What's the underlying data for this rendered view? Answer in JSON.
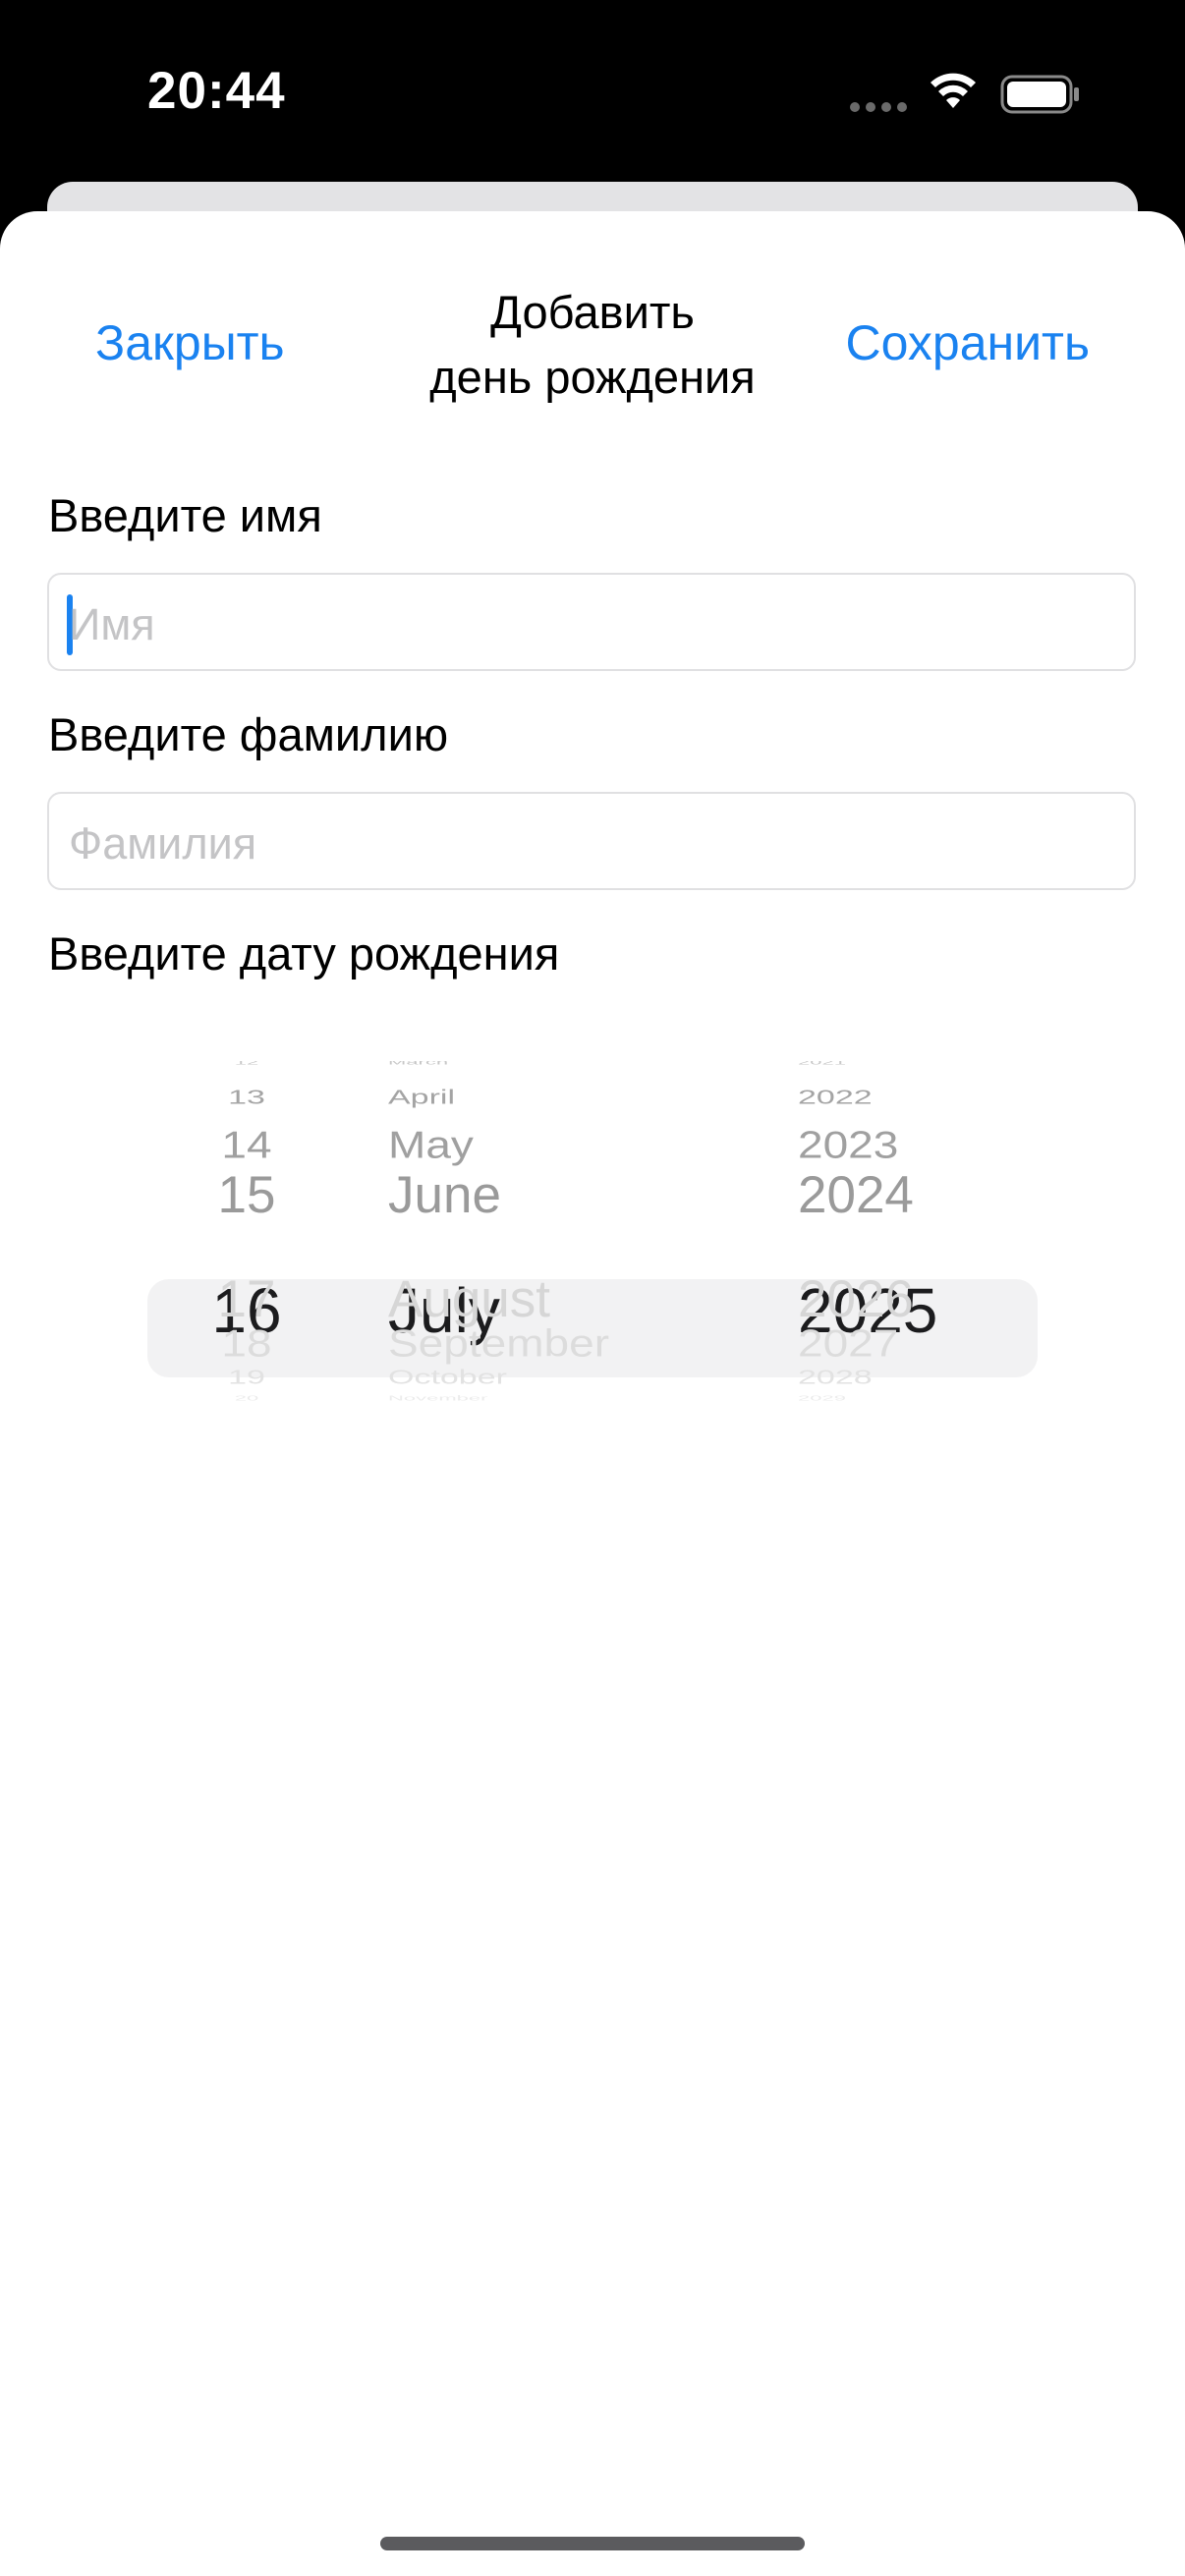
{
  "status_bar": {
    "time": "20:44",
    "icons": [
      "cellular-dots-icon",
      "wifi-icon",
      "battery-icon"
    ]
  },
  "nav": {
    "close_label": "Закрыть",
    "title_line1": "Добавить",
    "title_line2": "день рождения",
    "save_label": "Сохранить"
  },
  "form": {
    "name_label": "Введите имя",
    "name_placeholder": "Имя",
    "name_value": "",
    "surname_label": "Введите фамилию",
    "surname_placeholder": "Фамилия",
    "surname_value": "",
    "date_label": "Введите дату рождения"
  },
  "date_picker": {
    "days": [
      "12",
      "13",
      "14",
      "15",
      "16",
      "17",
      "18",
      "19",
      "20"
    ],
    "months": [
      "March",
      "April",
      "May",
      "June",
      "July",
      "August",
      "September",
      "October",
      "November"
    ],
    "years": [
      "2021",
      "2022",
      "2023",
      "2024",
      "2025",
      "2026",
      "2027",
      "2028",
      "2029"
    ],
    "selected": {
      "day": "16",
      "month": "July",
      "year": "2025"
    }
  },
  "colors": {
    "accent": "#1a82f0",
    "sheet_bg": "#ffffff",
    "status_bg": "#000000",
    "placeholder": "#c4c4c6",
    "picker_highlight": "#f2f2f3"
  }
}
